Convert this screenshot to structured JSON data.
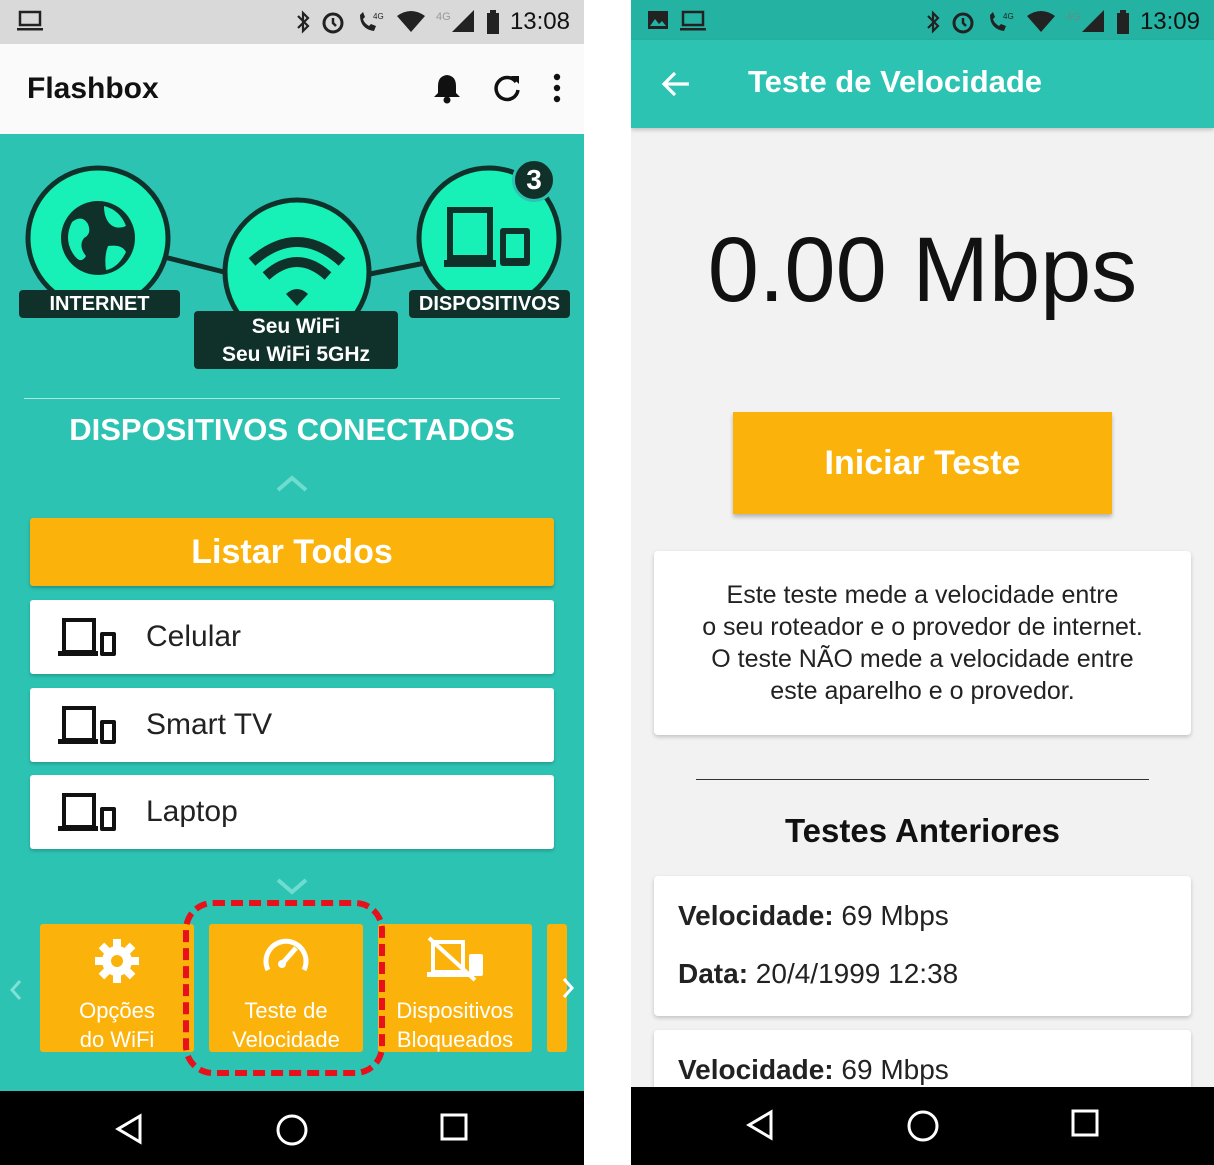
{
  "left_screen": {
    "status": {
      "time": "13:08"
    },
    "app_title": "Flashbox",
    "topology": {
      "internet_label": "INTERNET",
      "wifi_label_1": "Seu WiFi",
      "wifi_label_2": "Seu WiFi 5GHz",
      "devices_label": "DISPOSITIVOS",
      "devices_count": "3"
    },
    "section_title": "DISPOSITIVOS CONECTADOS",
    "list_all_label": "Listar Todos",
    "devices": [
      "Celular",
      "Smart TV",
      "Laptop"
    ],
    "carousel": [
      {
        "line1": "Opções",
        "line2": "do WiFi",
        "icon": "gear-icon"
      },
      {
        "line1": "Teste de",
        "line2": "Velocidade",
        "icon": "speedometer-icon"
      },
      {
        "line1": "Dispositivos",
        "line2": "Bloqueados",
        "icon": "blocked-devices-icon"
      }
    ]
  },
  "right_screen": {
    "status": {
      "time": "13:09"
    },
    "title": "Teste de Velocidade",
    "speed": "0.00 Mbps",
    "start_label": "Iniciar Teste",
    "info_lines": [
      "Este teste mede a velocidade entre",
      "o seu roteador e o provedor de internet.",
      "O teste NÃO mede a velocidade entre",
      "este aparelho e o provedor."
    ],
    "previous_title": "Testes Anteriores",
    "records": [
      {
        "speed_label": "Velocidade:",
        "speed_value": "69 Mbps",
        "date_label": "Data:",
        "date_value": "20/4/1999 12:38"
      },
      {
        "speed_label": "Velocidade:",
        "speed_value": "69 Mbps"
      }
    ]
  },
  "colors": {
    "teal": "#2cc3b3",
    "orange": "#fbb30c",
    "dark": "#10302a",
    "mint": "#17f0b6",
    "highlight": "#e8101a"
  }
}
